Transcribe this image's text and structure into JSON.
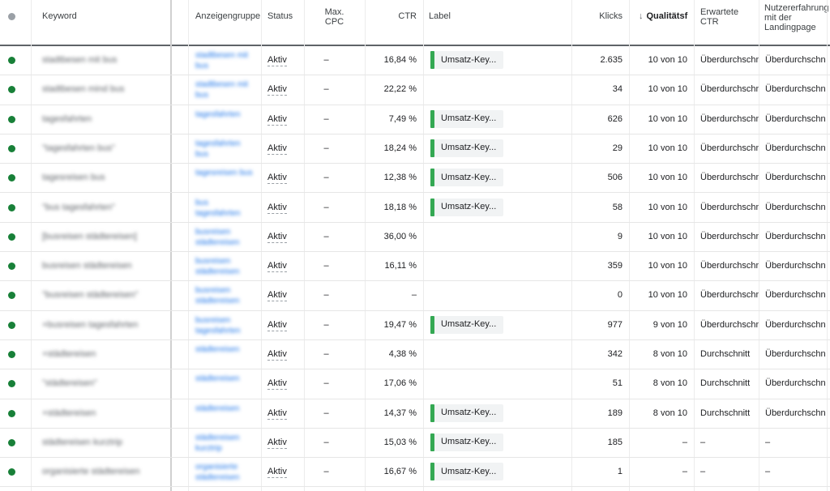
{
  "columns": {
    "keyword": "Keyword",
    "adgroup": "Anzeigengruppe",
    "status": "Status",
    "maxcpc": "Max. CPC",
    "ctr": "CTR",
    "label": "Label",
    "clicks": "Klicks",
    "quality": "Qualitätsf",
    "expected_ctr": "Erwartete CTR",
    "landing": "Nutzererfahrung mit der Landingpage"
  },
  "colors": {
    "status_dot": "#188038",
    "label_bar": "#34a853",
    "link": "#1a73e8"
  },
  "rows": [
    {
      "keyword": "stadtbesen mit bus",
      "adgroup": "stadtbesen mit bus",
      "status": "Aktiv",
      "maxcpc": "–",
      "ctr": "16,84 %",
      "label": "Umsatz-Key...",
      "clicks": "2.635",
      "quality": "10 von 10",
      "expected_ctr": "Überdurchschni",
      "landing": "Überdurchschn"
    },
    {
      "keyword": "stadtbesen mind bus",
      "adgroup": "stadtbesen mit bus",
      "status": "Aktiv",
      "maxcpc": "–",
      "ctr": "22,22 %",
      "label": "",
      "clicks": "34",
      "quality": "10 von 10",
      "expected_ctr": "Überdurchschni",
      "landing": "Überdurchschn"
    },
    {
      "keyword": "tagesfahrten",
      "adgroup": "tagesfahrten",
      "status": "Aktiv",
      "maxcpc": "–",
      "ctr": "7,49 %",
      "label": "Umsatz-Key...",
      "clicks": "626",
      "quality": "10 von 10",
      "expected_ctr": "Überdurchschni",
      "landing": "Überdurchschn"
    },
    {
      "keyword": "\"tagesfahrten bus\"",
      "adgroup": "tagesfahrten bus",
      "status": "Aktiv",
      "maxcpc": "–",
      "ctr": "18,24 %",
      "label": "Umsatz-Key...",
      "clicks": "29",
      "quality": "10 von 10",
      "expected_ctr": "Überdurchschni",
      "landing": "Überdurchschn"
    },
    {
      "keyword": "tagesreisen bus",
      "adgroup": "tagesreisen bus",
      "status": "Aktiv",
      "maxcpc": "–",
      "ctr": "12,38 %",
      "label": "Umsatz-Key...",
      "clicks": "506",
      "quality": "10 von 10",
      "expected_ctr": "Überdurchschni",
      "landing": "Überdurchschn"
    },
    {
      "keyword": "\"bus tagesfahrten\"",
      "adgroup": "bus tagesfahrten",
      "status": "Aktiv",
      "maxcpc": "–",
      "ctr": "18,18 %",
      "label": "Umsatz-Key...",
      "clicks": "58",
      "quality": "10 von 10",
      "expected_ctr": "Überdurchschni",
      "landing": "Überdurchschn"
    },
    {
      "keyword": "[busreisen städtereisen]",
      "adgroup": "busreisen städtereisen",
      "status": "Aktiv",
      "maxcpc": "–",
      "ctr": "36,00 %",
      "label": "",
      "clicks": "9",
      "quality": "10 von 10",
      "expected_ctr": "Überdurchschni",
      "landing": "Überdurchschn"
    },
    {
      "keyword": "busreisen städtereisen",
      "adgroup": "busreisen städtereisen",
      "status": "Aktiv",
      "maxcpc": "–",
      "ctr": "16,11 %",
      "label": "",
      "clicks": "359",
      "quality": "10 von 10",
      "expected_ctr": "Überdurchschni",
      "landing": "Überdurchschn"
    },
    {
      "keyword": "\"busreisen städtereisen\"",
      "adgroup": "busreisen städtereisen",
      "status": "Aktiv",
      "maxcpc": "–",
      "ctr": "–",
      "label": "",
      "clicks": "0",
      "quality": "10 von 10",
      "expected_ctr": "Überdurchschni",
      "landing": "Überdurchschn"
    },
    {
      "keyword": "+busreisen tagesfahrten",
      "adgroup": "busreisen tagesfahrten",
      "status": "Aktiv",
      "maxcpc": "–",
      "ctr": "19,47 %",
      "label": "Umsatz-Key...",
      "clicks": "977",
      "quality": "9 von 10",
      "expected_ctr": "Überdurchschni",
      "landing": "Überdurchschn"
    },
    {
      "keyword": "+städtereisen",
      "adgroup": "städtereisen",
      "status": "Aktiv",
      "maxcpc": "–",
      "ctr": "4,38 %",
      "label": "",
      "clicks": "342",
      "quality": "8 von 10",
      "expected_ctr": "Durchschnitt",
      "landing": "Überdurchschn"
    },
    {
      "keyword": "\"städtereisen\"",
      "adgroup": "städtereisen",
      "status": "Aktiv",
      "maxcpc": "–",
      "ctr": "17,06 %",
      "label": "",
      "clicks": "51",
      "quality": "8 von 10",
      "expected_ctr": "Durchschnitt",
      "landing": "Überdurchschn"
    },
    {
      "keyword": "+städtereisen",
      "adgroup": "städtereisen",
      "status": "Aktiv",
      "maxcpc": "–",
      "ctr": "14,37 %",
      "label": "Umsatz-Key...",
      "clicks": "189",
      "quality": "8 von 10",
      "expected_ctr": "Durchschnitt",
      "landing": "Überdurchschn"
    },
    {
      "keyword": "städtereisen kurztrip",
      "adgroup": "städtereisen kurztrip",
      "status": "Aktiv",
      "maxcpc": "–",
      "ctr": "15,03 %",
      "label": "Umsatz-Key...",
      "clicks": "185",
      "quality": "–",
      "expected_ctr": "–",
      "landing": "–"
    },
    {
      "keyword": "organisierte städtereisen",
      "adgroup": "organisierte städtereisen",
      "status": "Aktiv",
      "maxcpc": "–",
      "ctr": "16,67 %",
      "label": "Umsatz-Key...",
      "clicks": "1",
      "quality": "–",
      "expected_ctr": "–",
      "landing": "–"
    }
  ]
}
